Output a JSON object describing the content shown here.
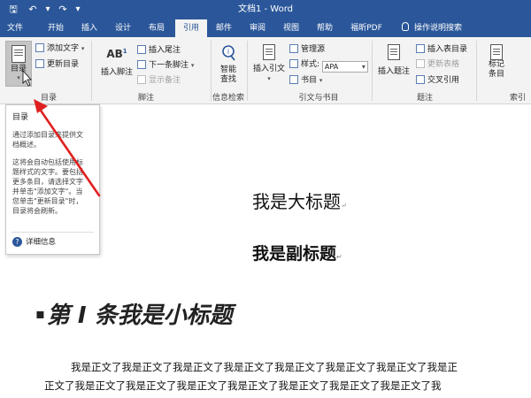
{
  "window": {
    "title": "文档1 - Word",
    "qat": {
      "save": "🖫",
      "undo": "↶",
      "undo_dd": "▾",
      "redo": "↷",
      "customize": "▾"
    }
  },
  "tabs": [
    "文件",
    "开始",
    "插入",
    "设计",
    "布局",
    "引用",
    "邮件",
    "审阅",
    "视图",
    "帮助",
    "福昕PDF"
  ],
  "active_tab": "引用",
  "tellme": "操作说明搜索",
  "ribbon": {
    "toc": {
      "button": "目录",
      "add_text": "添加文字",
      "update_toc": "更新目录",
      "group": "目录"
    },
    "footnotes": {
      "insert_footnote": "插入脚注",
      "insert_endnote": "插入尾注",
      "next_footnote": "下一条脚注",
      "show_notes": "显示备注",
      "ab_icon": "AB",
      "ab_sup": "1",
      "group": "脚注"
    },
    "research": {
      "smart_lookup_1": "智能",
      "smart_lookup_2": "查找",
      "group": "信息检索"
    },
    "citations": {
      "insert_citation": "插入引文",
      "manage_sources": "管理源",
      "style_label": "样式:",
      "style_value": "APA",
      "bibliography": "书目",
      "group": "引文与书目"
    },
    "captions": {
      "insert_caption": "插入题注",
      "insert_table_figures": "插入表目录",
      "update_table": "更新表格",
      "cross_reference": "交叉引用",
      "group": "题注"
    },
    "index": {
      "mark_entry_1": "标记",
      "mark_entry_2": "条目",
      "group": "索引"
    }
  },
  "tooltip": {
    "title": "目录",
    "lines1": [
      "通过添加目录来提供文",
      "档概述。"
    ],
    "lines2": [
      "这将会自动包括使用标",
      "题样式的文字。要包括",
      "更多条目，请选择文字",
      "并单击\"添加文字\"。当",
      "您单击\"更新目录\"时，",
      "目录将会刷新。"
    ],
    "more": "详细信息",
    "help_glyph": "?"
  },
  "document": {
    "title": "我是大标题",
    "subtitle": "我是副标题",
    "heading": "第 I 条我是小标题",
    "body_line1": "我是正文了我是正文了我是正文了我是正文了我是正文了我是正文了我是正文了我是正",
    "body_line2": "正文了我是正文了我是正文了我是正文了我是正文了我是正文了我是正文了我是正文了我",
    "para_mark": "↵",
    "heading_marker": "▪"
  },
  "colors": {
    "word_blue": "#2b579a",
    "ribbon_bg": "#f3f3f3",
    "annotation_red": "#e02020"
  }
}
